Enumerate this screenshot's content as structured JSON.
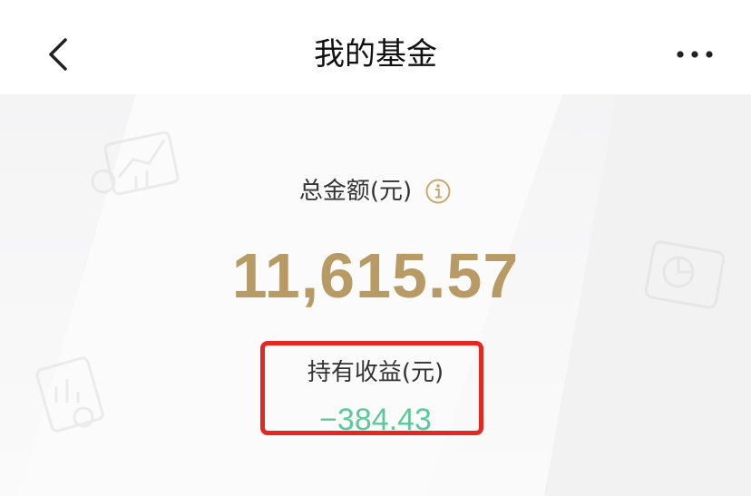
{
  "nav": {
    "title": "我的基金",
    "back_icon": "chevron-left-icon",
    "more_icon": "more-horizontal-icon"
  },
  "summary": {
    "total_label": "总金额(元)",
    "info_icon": "info-icon",
    "total_amount": "11,615.57",
    "holding_profit_label": "持有收益(元)",
    "holding_profit_value": "−384.43"
  },
  "colors": {
    "amount_gold": "#b79a64",
    "profit_green": "#5cc89b",
    "highlight_red": "#e42820",
    "info_gold": "#c9a86a"
  }
}
